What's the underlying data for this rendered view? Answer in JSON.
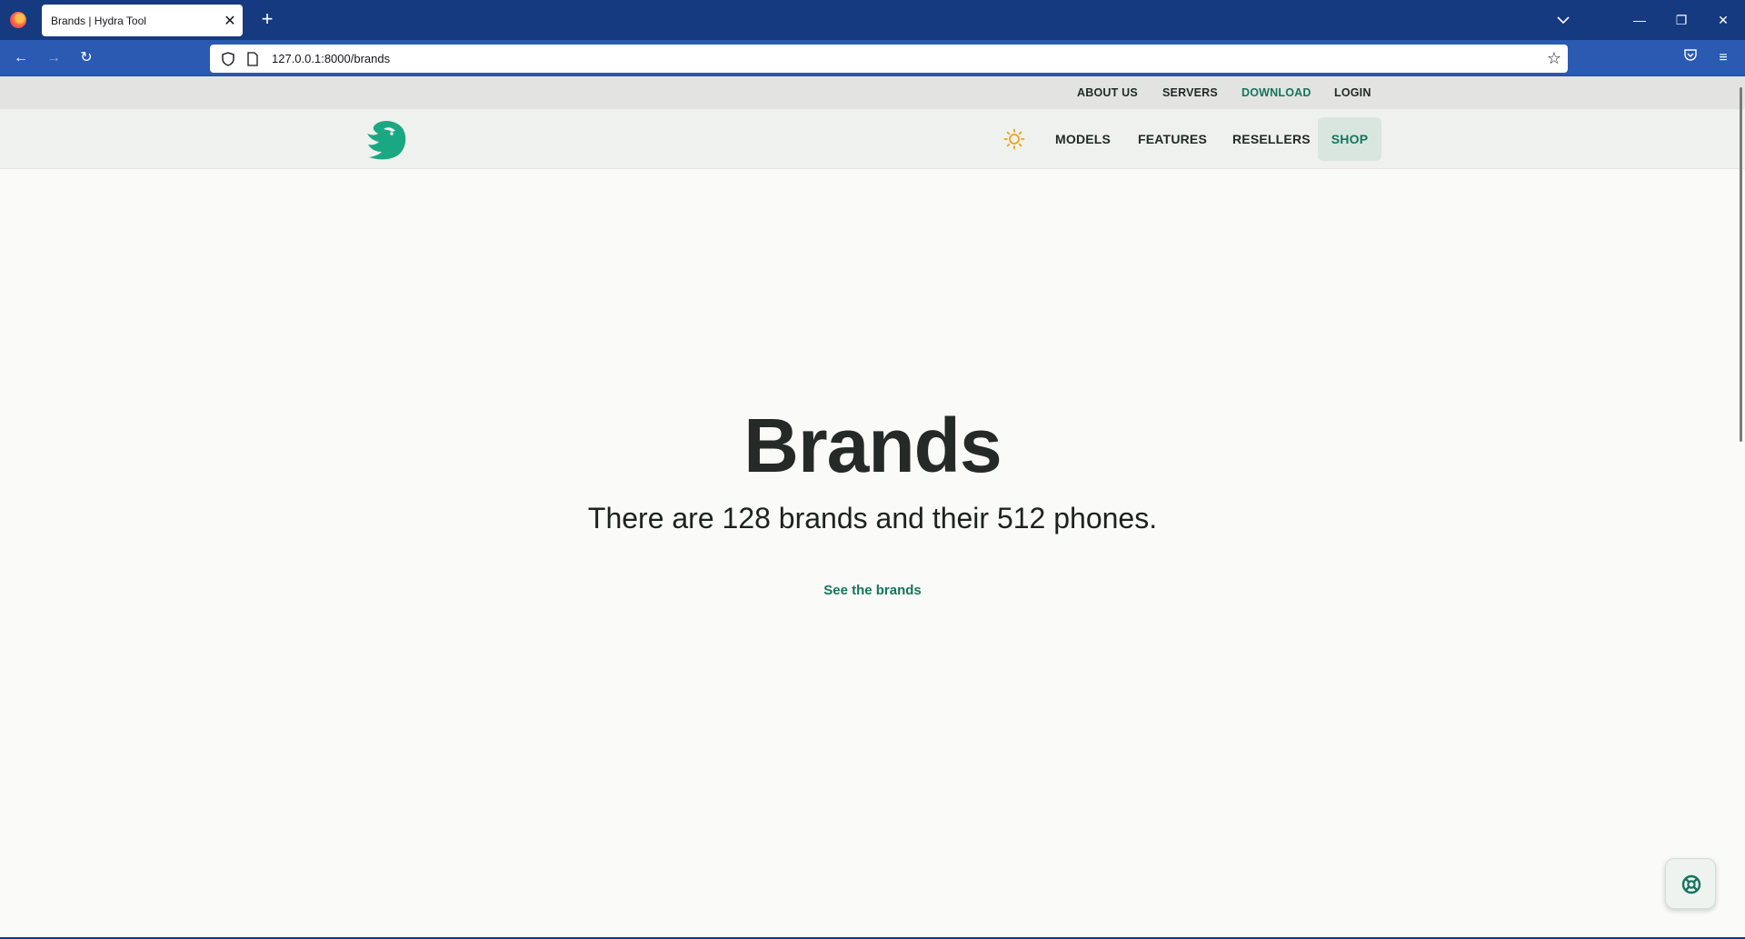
{
  "browser": {
    "tab_title": "Brands | Hydra Tool",
    "url": "127.0.0.1:8000/brands",
    "icons": {
      "browser": "firefox-icon",
      "close_tab": "close-icon",
      "new_tab": "plus-icon",
      "tabs_list": "chevron-down-icon",
      "back": "arrow-left-icon",
      "forward": "arrow-right-icon",
      "reload": "reload-icon",
      "shield": "shield-icon",
      "page": "page-icon",
      "bookmark": "star-icon",
      "pocket": "pocket-icon",
      "menu": "hamburger-icon"
    }
  },
  "site": {
    "topbar": {
      "about": "ABOUT US",
      "servers": "SERVERS",
      "download": "DOWNLOAD",
      "login": "LOGIN"
    },
    "nav": {
      "models": "MODELS",
      "features": "FEATURES",
      "resellers": "RESELLERS",
      "shop": "SHOP"
    },
    "hero": {
      "title": "Brands",
      "subtitle": "There are 128 brands and their 512 phones.",
      "link": "See the brands"
    },
    "colors": {
      "accent": "#16745d",
      "sun": "#f0a21c",
      "logo": "#1aa882"
    }
  }
}
